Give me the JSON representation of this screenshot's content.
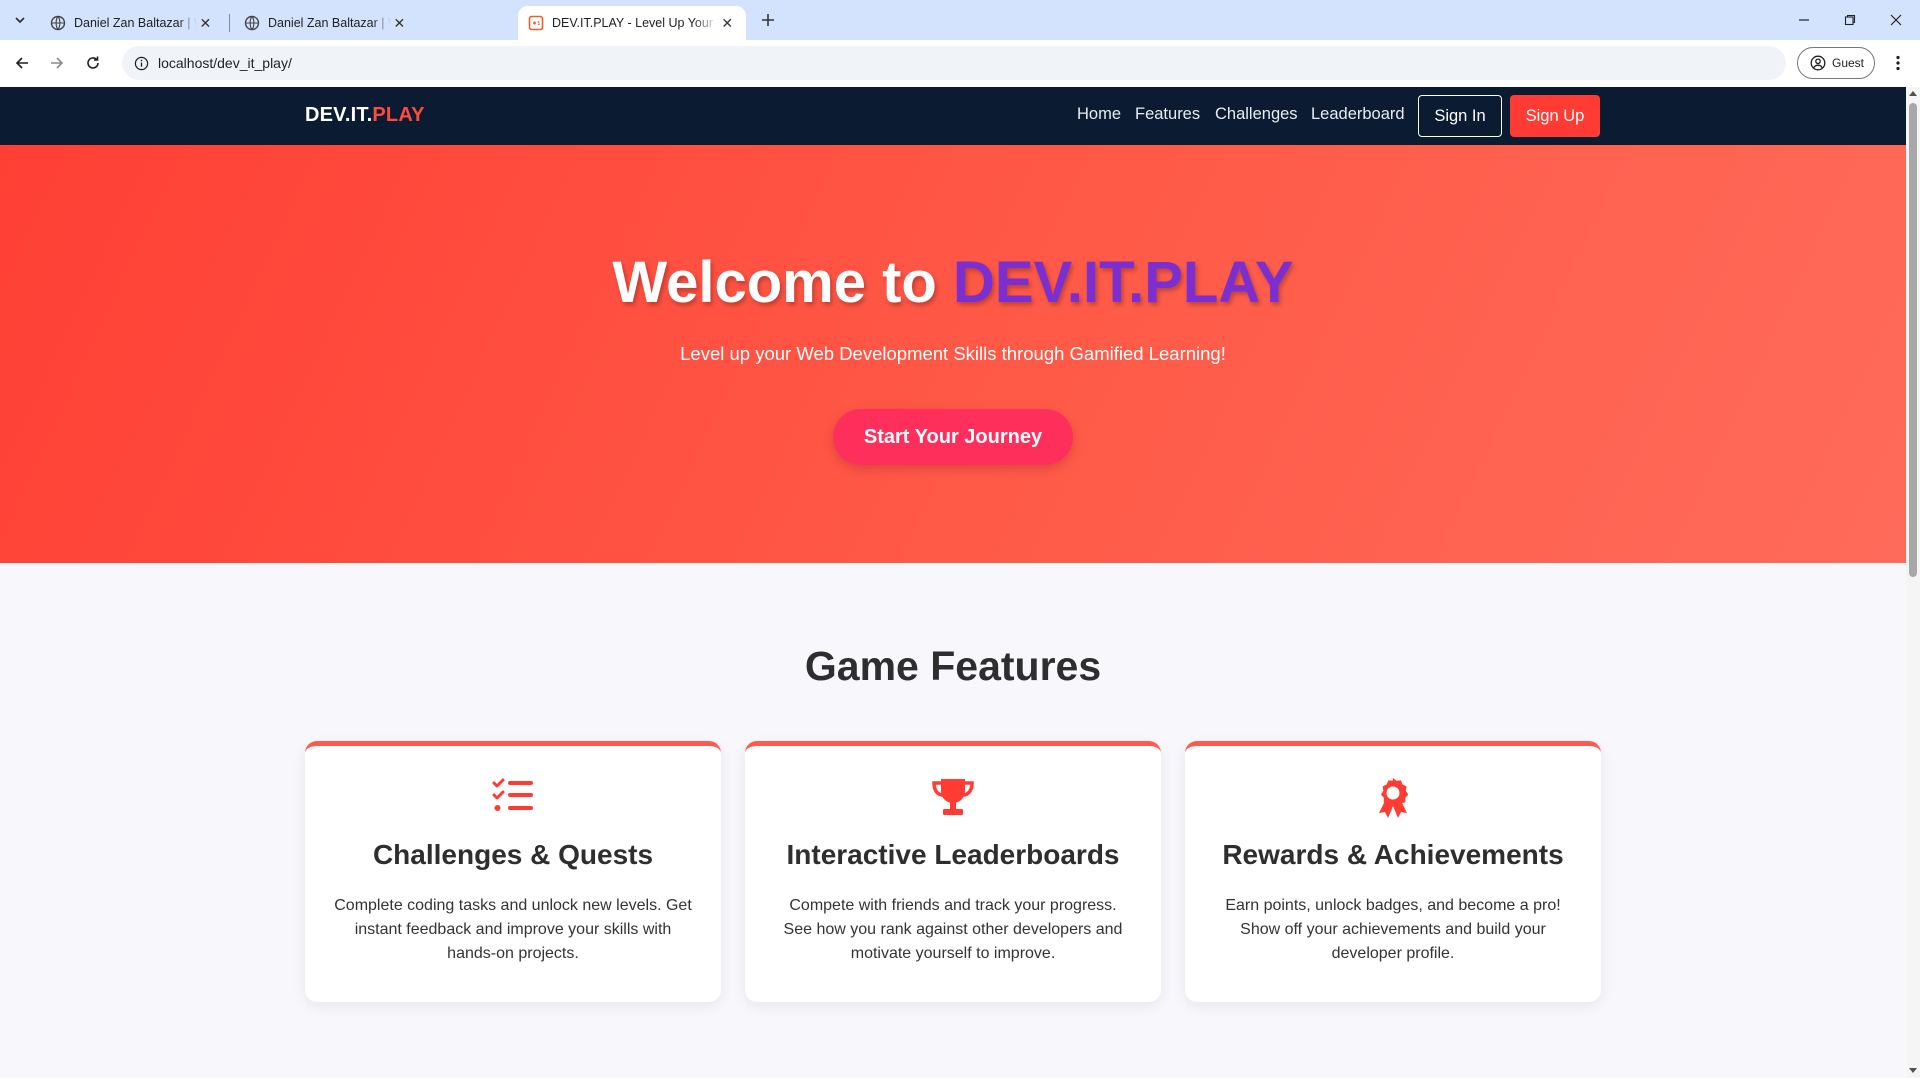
{
  "browser": {
    "tabs": [
      {
        "title": "Daniel Zan Baltazar | Web Developer",
        "active": false
      },
      {
        "title": "Daniel Zan Baltazar | Web Developer",
        "active": false
      },
      {
        "title": "DEV.IT.PLAY - Level Up Your Web Development Skills",
        "active": true
      }
    ],
    "url": "localhost/dev_it_play/",
    "profile_label": "Guest"
  },
  "site": {
    "brand": {
      "part1": "DEV.IT.",
      "part2": "PLAY"
    },
    "nav": {
      "links": [
        "Home",
        "Features",
        "Challenges",
        "Leaderboard"
      ],
      "sign_in": "Sign In",
      "sign_up": "Sign Up"
    },
    "hero": {
      "title_prefix": "Welcome to ",
      "title_highlight": "DEV.IT.PLAY",
      "subtitle": "Level up your Web Development Skills through Gamified Learning!",
      "cta": "Start Your Journey"
    },
    "features": {
      "title": "Game Features",
      "cards": [
        {
          "icon": "checklist-icon",
          "title": "Challenges & Quests",
          "text": "Complete coding tasks and unlock new levels. Get instant feedback and improve your skills with hands-on projects."
        },
        {
          "icon": "trophy-icon",
          "title": "Interactive Leaderboards",
          "text": "Compete with friends and track your progress. See how you rank against other developers and motivate yourself to improve."
        },
        {
          "icon": "award-icon",
          "title": "Rewards & Achievements",
          "text": "Earn points, unlock badges, and become a pro! Show off your achievements and build your developer profile."
        }
      ]
    }
  },
  "colors": {
    "nav_bg": "#0b1b31",
    "accent_red": "#ff3b33",
    "hero_highlight": "#7b2fd0",
    "cta_pink": "#ff2f5c",
    "browser_frame": "#d3e3fd"
  }
}
